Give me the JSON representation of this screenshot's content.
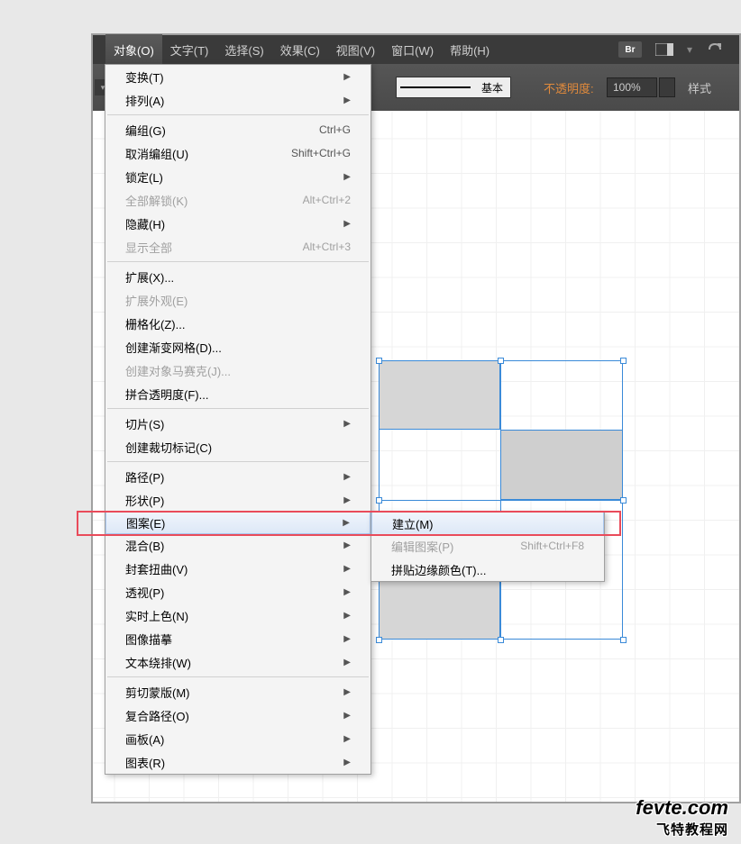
{
  "menubar": {
    "items": [
      {
        "label": "对象(O)",
        "active": true
      },
      {
        "label": "文字(T)"
      },
      {
        "label": "选择(S)"
      },
      {
        "label": "效果(C)"
      },
      {
        "label": "视图(V)"
      },
      {
        "label": "窗口(W)"
      },
      {
        "label": "帮助(H)"
      }
    ],
    "bridge_label": "Br"
  },
  "toolbar": {
    "stroke_label": "基本",
    "opacity_label": "不透明度:",
    "opacity_value": "100%",
    "style_label": "样式"
  },
  "dropdown": {
    "groups": [
      [
        {
          "label": "变换(T)",
          "submenu": true
        },
        {
          "label": "排列(A)",
          "submenu": true
        }
      ],
      [
        {
          "label": "编组(G)",
          "shortcut": "Ctrl+G"
        },
        {
          "label": "取消编组(U)",
          "shortcut": "Shift+Ctrl+G"
        },
        {
          "label": "锁定(L)",
          "submenu": true
        },
        {
          "label": "全部解锁(K)",
          "shortcut": "Alt+Ctrl+2",
          "disabled": true
        },
        {
          "label": "隐藏(H)",
          "submenu": true
        },
        {
          "label": "显示全部",
          "shortcut": "Alt+Ctrl+3",
          "disabled": true
        }
      ],
      [
        {
          "label": "扩展(X)..."
        },
        {
          "label": "扩展外观(E)",
          "disabled": true
        },
        {
          "label": "栅格化(Z)..."
        },
        {
          "label": "创建渐变网格(D)..."
        },
        {
          "label": "创建对象马赛克(J)...",
          "disabled": true
        },
        {
          "label": "拼合透明度(F)..."
        }
      ],
      [
        {
          "label": "切片(S)",
          "submenu": true
        },
        {
          "label": "创建裁切标记(C)"
        }
      ],
      [
        {
          "label": "路径(P)",
          "submenu": true
        },
        {
          "label": "形状(P)",
          "submenu": true
        },
        {
          "label": "图案(E)",
          "submenu": true,
          "highlight": true
        },
        {
          "label": "混合(B)",
          "submenu": true
        },
        {
          "label": "封套扭曲(V)",
          "submenu": true
        },
        {
          "label": "透视(P)",
          "submenu": true
        },
        {
          "label": "实时上色(N)",
          "submenu": true
        },
        {
          "label": "图像描摹",
          "submenu": true
        },
        {
          "label": "文本绕排(W)",
          "submenu": true
        }
      ],
      [
        {
          "label": "剪切蒙版(M)",
          "submenu": true
        },
        {
          "label": "复合路径(O)",
          "submenu": true
        },
        {
          "label": "画板(A)",
          "submenu": true
        },
        {
          "label": "图表(R)",
          "submenu": true
        }
      ]
    ]
  },
  "submenu_pattern": {
    "items": [
      {
        "label": "建立(M)",
        "highlight": true
      },
      {
        "label": "编辑图案(P)",
        "shortcut": "Shift+Ctrl+F8",
        "disabled": true
      },
      {
        "label": "拼贴边缘颜色(T)..."
      }
    ]
  },
  "watermark": {
    "line1": "fevte.com",
    "line2": "飞特教程网"
  }
}
